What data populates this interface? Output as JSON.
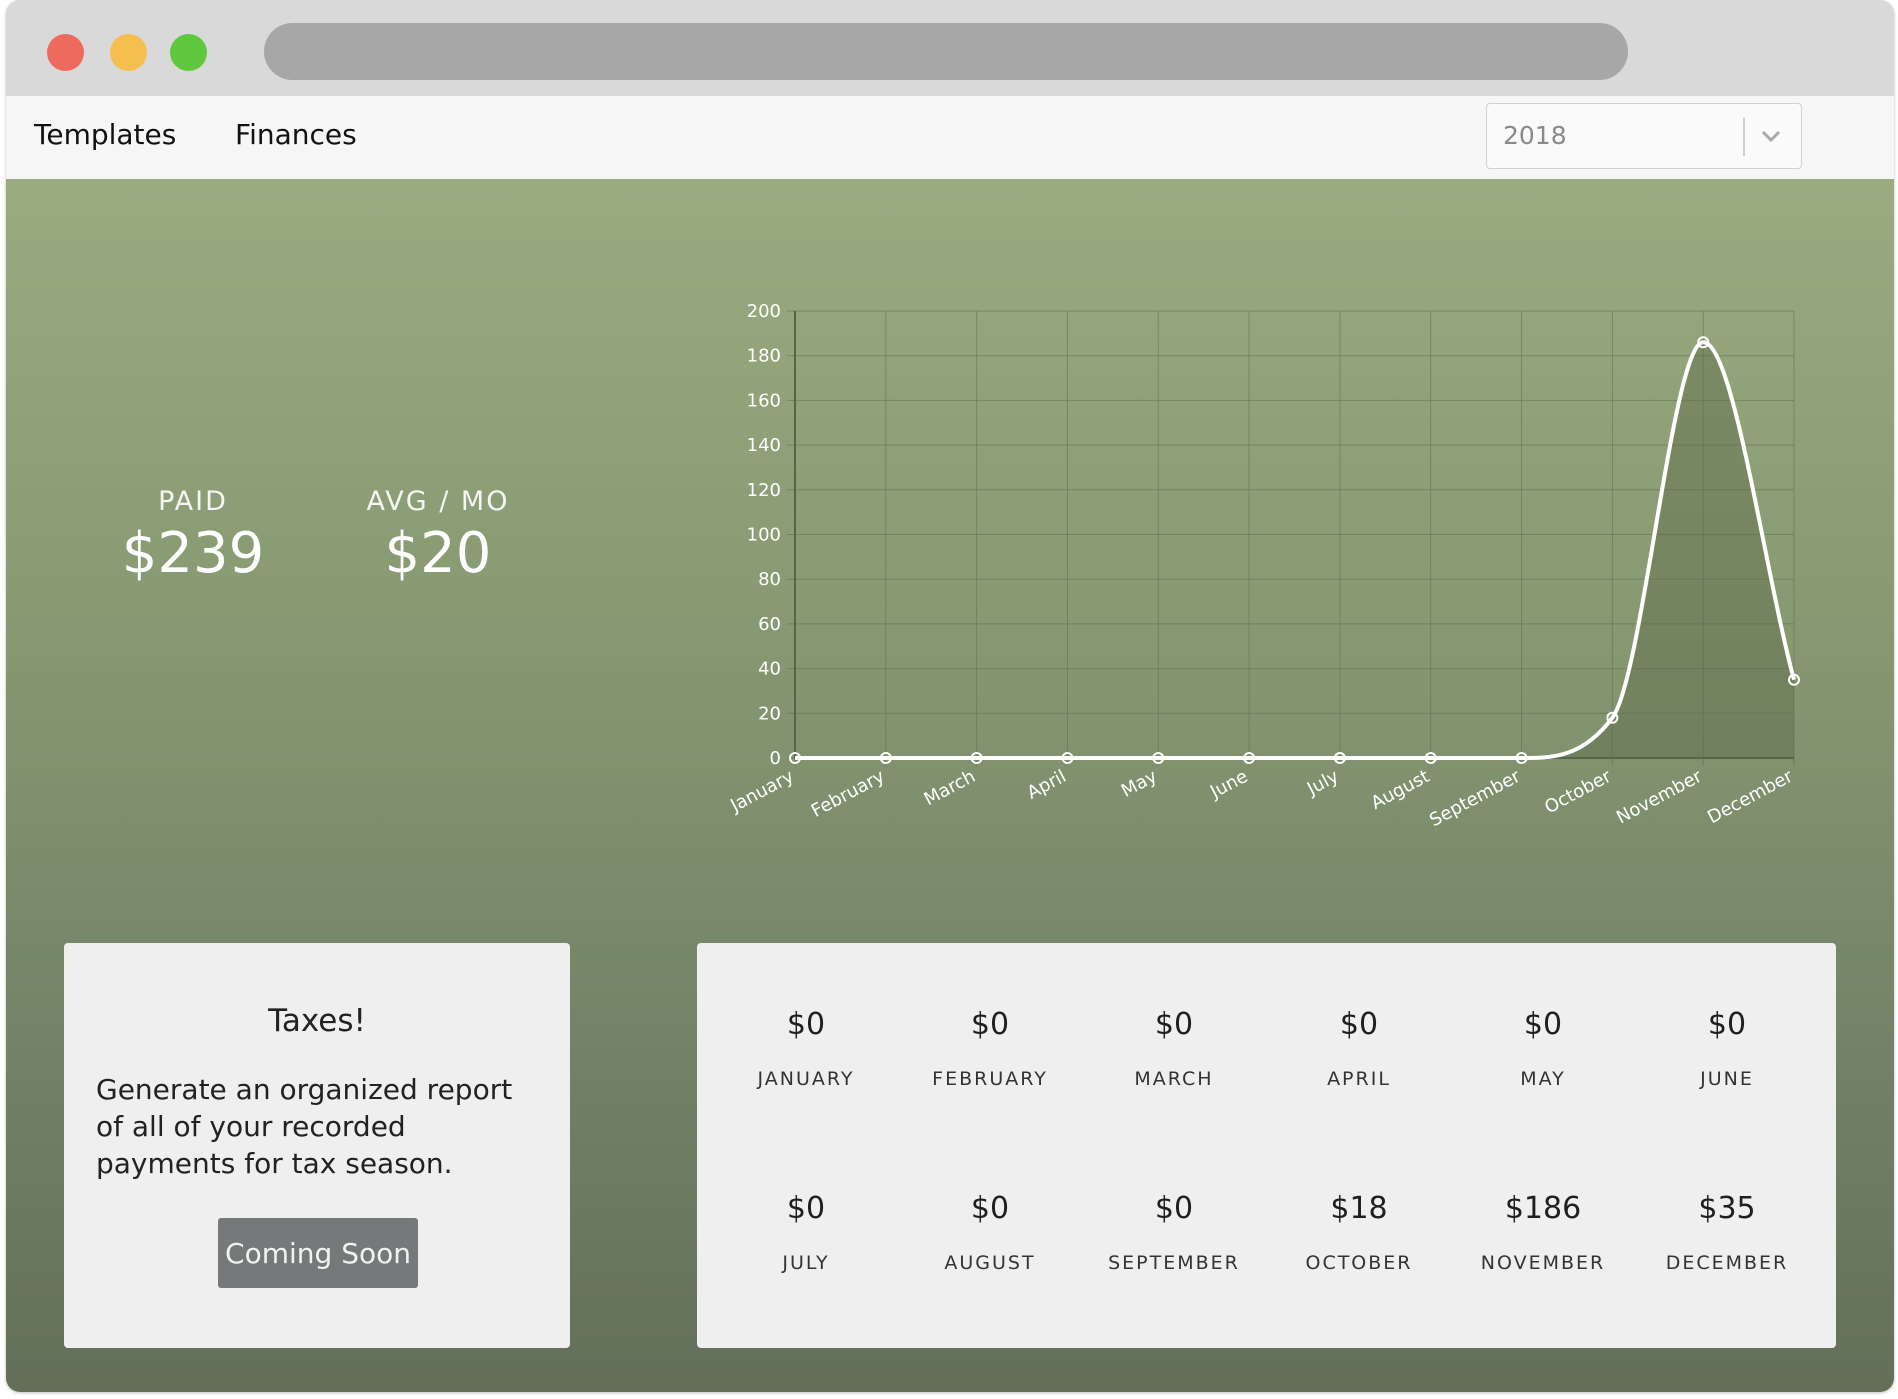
{
  "nav": {
    "templates": "Templates",
    "finances": "Finances",
    "year_select": {
      "selected": "2018",
      "icon": "chevron-down-icon"
    }
  },
  "stats": {
    "paid": {
      "label": "PAID",
      "value": "$239"
    },
    "avg": {
      "label": "AVG / MO",
      "value": "$20"
    }
  },
  "chart_data": {
    "type": "area",
    "categories": [
      "January",
      "February",
      "March",
      "April",
      "May",
      "June",
      "July",
      "August",
      "September",
      "October",
      "November",
      "December"
    ],
    "series": [
      {
        "values": [
          0,
          0,
          0,
          0,
          0,
          0,
          0,
          0,
          0,
          18,
          186,
          35
        ]
      }
    ],
    "ylim": [
      0,
      200
    ],
    "yticks": [
      0,
      20,
      40,
      60,
      80,
      100,
      120,
      140,
      160,
      180,
      200
    ],
    "grid": true,
    "legend": "none",
    "colors": {
      "line": "#ffffff",
      "grid": "#5f6f52",
      "fill": "#5d6a4c"
    }
  },
  "taxes": {
    "title": "Taxes!",
    "description": "Generate an organized report of all of your recorded payments for tax season.",
    "button": "Coming Soon"
  },
  "months": [
    {
      "amount": "$0",
      "name": "JANUARY"
    },
    {
      "amount": "$0",
      "name": "FEBRUARY"
    },
    {
      "amount": "$0",
      "name": "MARCH"
    },
    {
      "amount": "$0",
      "name": "APRIL"
    },
    {
      "amount": "$0",
      "name": "MAY"
    },
    {
      "amount": "$0",
      "name": "JUNE"
    },
    {
      "amount": "$0",
      "name": "JULY"
    },
    {
      "amount": "$0",
      "name": "AUGUST"
    },
    {
      "amount": "$0",
      "name": "SEPTEMBER"
    },
    {
      "amount": "$18",
      "name": "OCTOBER"
    },
    {
      "amount": "$186",
      "name": "NOVEMBER"
    },
    {
      "amount": "$35",
      "name": "DECEMBER"
    }
  ]
}
